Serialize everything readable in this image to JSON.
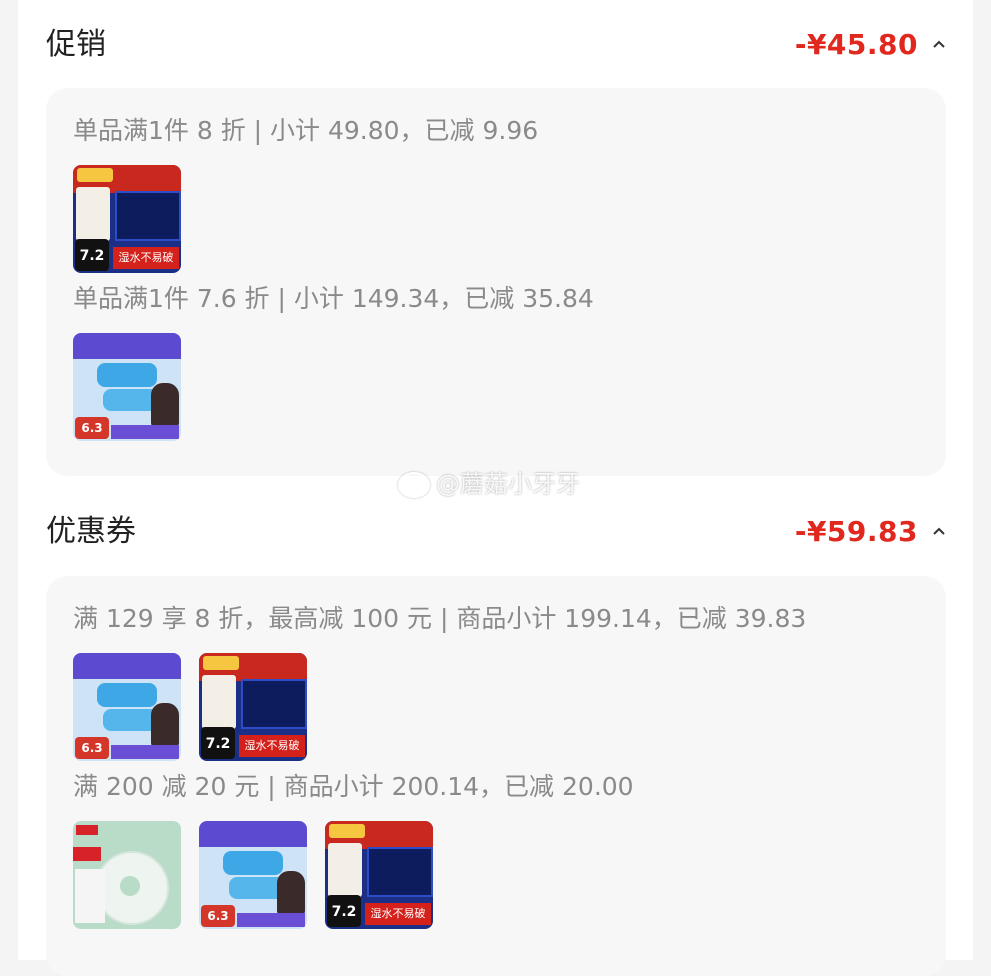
{
  "promotion": {
    "title": "促销",
    "amount": "-¥45.80",
    "rules": [
      {
        "text": "单品满1件 8 折 | 小计 49.80，已减 9.96",
        "thumbs": [
          "tissue-product"
        ]
      },
      {
        "text": "单品满1件 7.6 折 | 小计 149.34，已减 35.84",
        "thumbs": [
          "wipes-product"
        ]
      }
    ]
  },
  "coupon": {
    "title": "优惠券",
    "amount": "-¥59.83",
    "rules": [
      {
        "text": "满 129 享 8 折，最高减 100 元 | 商品小计 199.14，已减 39.83",
        "thumbs": [
          "wipes-product",
          "tissue-product"
        ]
      },
      {
        "text": "满 200 减 20 元 | 商品小计 200.14，已减 20.00",
        "thumbs": [
          "tape-product",
          "wipes-product",
          "tissue-product"
        ]
      }
    ]
  },
  "thumb_text": {
    "tissue_badge": "7.2",
    "tissue_strip": "湿水不易破",
    "wipes_badge": "6.3"
  },
  "watermark": "@蘑菇小牙牙",
  "colors": {
    "accent": "#e0281e",
    "muted": "#8a8a8a",
    "panel": "#f7f7f7"
  }
}
